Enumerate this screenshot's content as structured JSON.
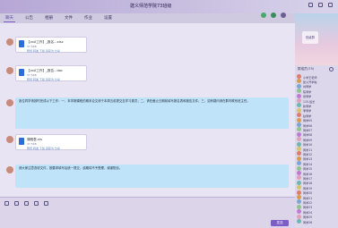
{
  "window": {
    "title": "建义师范学院73班级"
  },
  "tabs": [
    {
      "label": "聊天"
    },
    {
      "label": "公告"
    },
    {
      "label": "相册"
    },
    {
      "label": "文件"
    },
    {
      "label": "作业"
    },
    {
      "label": "设置"
    }
  ],
  "messages": {
    "file1": {
      "name": "【xxX工作】_报名...xlsx",
      "size": "37.5KB",
      "actions": "预览  转发  下载  另存为  分享"
    },
    "file2": {
      "name": "【xxX工作】_报告...doc",
      "size": "37.5KB",
      "actions": "预览  转发  下载  另存为  分享"
    },
    "text1": "各位同学请按时完成以下工作：一、本学期课程的期末论文请于本周五前提交至学习委员；二、请在截止日期前填写报名表和报告文件；三、如有疑问请在群内联系班主任。",
    "file3": {
      "name": "课程表.xls",
      "size": "37.5KB",
      "actions": "预览  转发  下载  另存为  分享"
    },
    "text2": "请大家注意查收文件，按要求填写后统一提交，逾期将不予受理，谢谢配合。"
  },
  "input": {
    "send_label": "发送"
  },
  "side": {
    "sticker": "班级群",
    "members_header": "群成员(75)",
    "members": [
      {
        "name": "小学王老师"
      },
      {
        "name": "建义开学啦"
      },
      {
        "name": "刘同学"
      },
      {
        "name": "陈同学"
      },
      {
        "name": "张同学"
      },
      {
        "name": "115-班长"
      },
      {
        "name": "新同学"
      },
      {
        "name": "李同学"
      },
      {
        "name": "赵同学"
      },
      {
        "name": "同学05"
      },
      {
        "name": "同学06"
      },
      {
        "name": "同学07"
      },
      {
        "name": "同学08"
      },
      {
        "name": "同学09"
      },
      {
        "name": "同学10"
      },
      {
        "name": "同学11"
      },
      {
        "name": "同学12"
      },
      {
        "name": "同学13"
      },
      {
        "name": "同学14"
      },
      {
        "name": "同学15"
      },
      {
        "name": "同学16"
      },
      {
        "name": "同学17"
      },
      {
        "name": "同学18"
      },
      {
        "name": "同学19"
      },
      {
        "name": "同学20"
      },
      {
        "name": "同学21"
      },
      {
        "name": "同学22"
      },
      {
        "name": "同学23"
      },
      {
        "name": "同学24"
      },
      {
        "name": "同学25"
      },
      {
        "name": "同学26"
      }
    ]
  },
  "colors": {
    "accent": "#7c5cc6",
    "bubble": "#bfe3f8",
    "doc_icon": "#2b6fd6"
  }
}
